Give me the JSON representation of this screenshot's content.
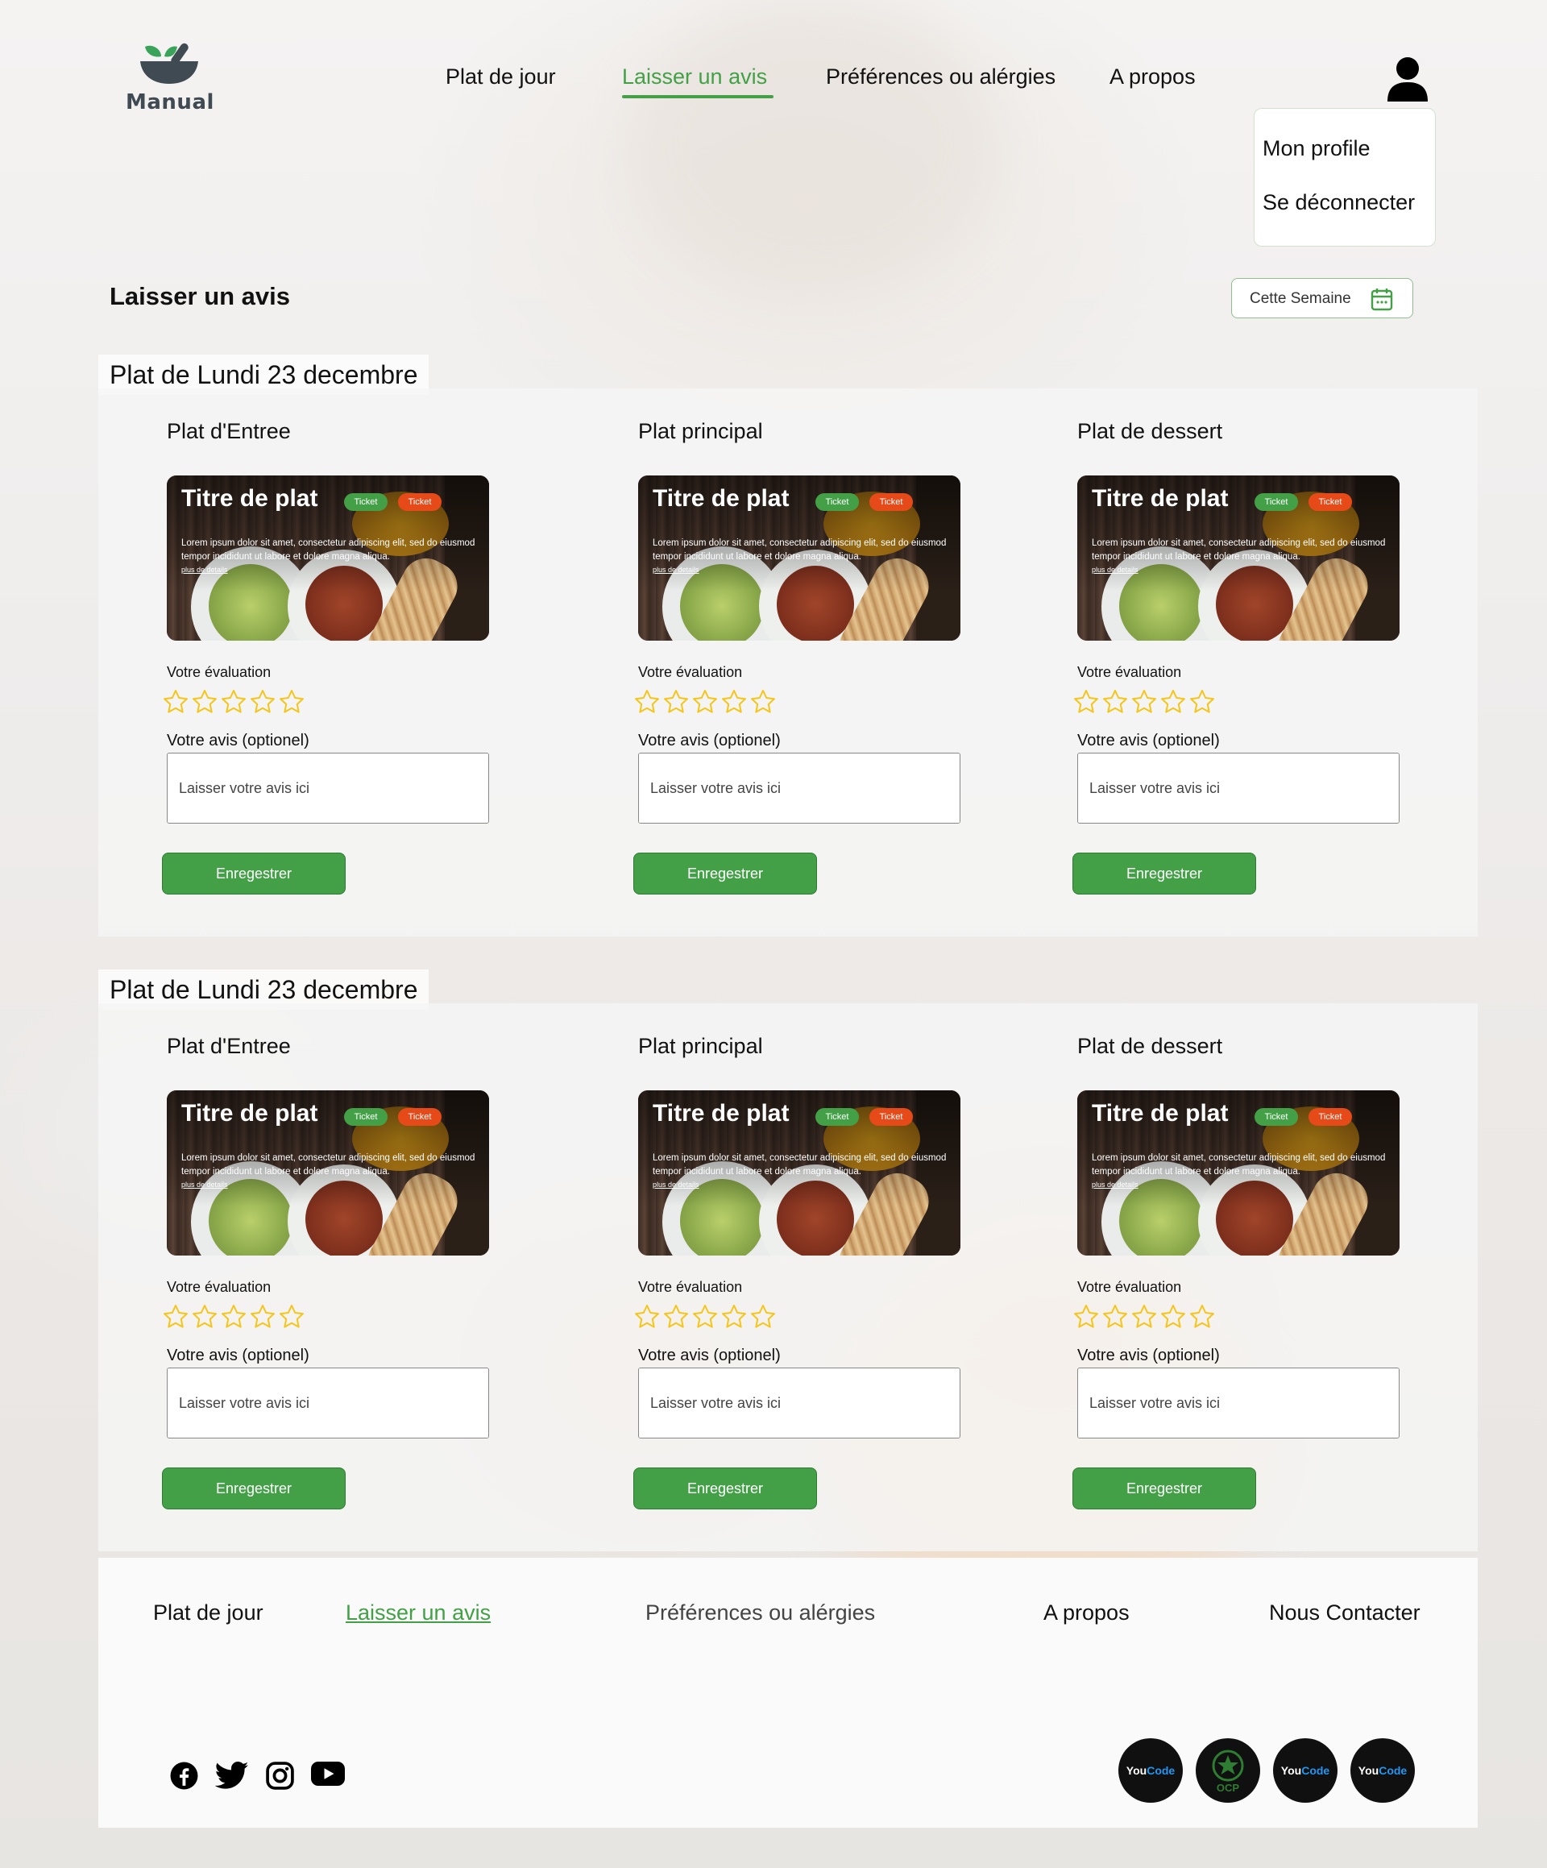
{
  "app": {
    "logo_text": "Manual"
  },
  "nav": {
    "items": [
      "Plat de jour",
      "Laisser un avis",
      "Préférences ou alérgies",
      "A propos"
    ],
    "active": "Laisser un avis"
  },
  "user_menu": {
    "items": [
      "Mon profile",
      "Se déconnecter"
    ]
  },
  "page": {
    "title": "Laisser un avis",
    "week_filter": "Cette Semaine"
  },
  "days": [
    {
      "title": "Plat de Lundi 23 decembre",
      "courses": [
        {
          "label": "Plat d'Entree",
          "dish_title": "Titre de plat",
          "tags": [
            "Ticket",
            "Ticket"
          ],
          "description": "Lorem ipsum dolor sit amet, consectetur adipiscing elit, sed do eiusmod tempor incididunt ut labore et dolore magna aliqua.",
          "more": "plus de details",
          "rating_label": "Votre évaluation",
          "rating": 0,
          "rating_max": 5,
          "opinion_label": "Votre avis (optionel)",
          "opinion_placeholder": "Laisser votre avis ici",
          "save": "Enregestrer"
        },
        {
          "label": "Plat principal",
          "dish_title": "Titre de plat",
          "tags": [
            "Ticket",
            "Ticket"
          ],
          "description": "Lorem ipsum dolor sit amet, consectetur adipiscing elit, sed do eiusmod tempor incididunt ut labore et dolore magna aliqua.",
          "more": "plus de details",
          "rating_label": "Votre évaluation",
          "rating": 0,
          "rating_max": 5,
          "opinion_label": "Votre avis (optionel)",
          "opinion_placeholder": "Laisser votre avis ici",
          "save": "Enregestrer"
        },
        {
          "label": "Plat de dessert",
          "dish_title": "Titre de plat",
          "tags": [
            "Ticket",
            "Ticket"
          ],
          "description": "Lorem ipsum dolor sit amet, consectetur adipiscing elit, sed do eiusmod tempor incididunt ut labore et dolore magna aliqua.",
          "more": "plus de details",
          "rating_label": "Votre évaluation",
          "rating": 0,
          "rating_max": 5,
          "opinion_label": "Votre avis (optionel)",
          "opinion_placeholder": "Laisser votre avis ici",
          "save": "Enregestrer"
        }
      ]
    },
    {
      "title": "Plat de Lundi 23 decembre",
      "courses": [
        {
          "label": "Plat d'Entree",
          "dish_title": "Titre de plat",
          "tags": [
            "Ticket",
            "Ticket"
          ],
          "description": "Lorem ipsum dolor sit amet, consectetur adipiscing elit, sed do eiusmod tempor incididunt ut labore et dolore magna aliqua.",
          "more": "plus de details",
          "rating_label": "Votre évaluation",
          "rating": 0,
          "rating_max": 5,
          "opinion_label": "Votre avis (optionel)",
          "opinion_placeholder": "Laisser votre avis ici",
          "save": "Enregestrer"
        },
        {
          "label": "Plat principal",
          "dish_title": "Titre de plat",
          "tags": [
            "Ticket",
            "Ticket"
          ],
          "description": "Lorem ipsum dolor sit amet, consectetur adipiscing elit, sed do eiusmod tempor incididunt ut labore et dolore magna aliqua.",
          "more": "plus de details",
          "rating_label": "Votre évaluation",
          "rating": 0,
          "rating_max": 5,
          "opinion_label": "Votre avis (optionel)",
          "opinion_placeholder": "Laisser votre avis ici",
          "save": "Enregestrer"
        },
        {
          "label": "Plat de dessert",
          "dish_title": "Titre de plat",
          "tags": [
            "Ticket",
            "Ticket"
          ],
          "description": "Lorem ipsum dolor sit amet, consectetur adipiscing elit, sed do eiusmod tempor incididunt ut labore et dolore magna aliqua.",
          "more": "plus de details",
          "rating_label": "Votre évaluation",
          "rating": 0,
          "rating_max": 5,
          "opinion_label": "Votre avis (optionel)",
          "opinion_placeholder": "Laisser votre avis ici",
          "save": "Enregestrer"
        }
      ]
    }
  ],
  "footer": {
    "links": [
      "Plat de jour",
      "Laisser un avis",
      "Préférences ou alérgies",
      "A propos",
      "Nous Contacter"
    ],
    "active": "Laisser un avis",
    "socials": [
      "facebook-icon",
      "twitter-icon",
      "instagram-icon",
      "youtube-icon"
    ],
    "partners": [
      {
        "name": "YouCode",
        "parts": [
          "You",
          "Code"
        ]
      },
      {
        "name": "OCP",
        "label": "OCP"
      },
      {
        "name": "YouCode",
        "parts": [
          "You",
          "Code"
        ]
      },
      {
        "name": "YouCode",
        "parts": [
          "You",
          "Code"
        ]
      }
    ]
  },
  "colors": {
    "accent": "#43a047",
    "tag_red": "#e64a19",
    "star": "#f5c518"
  }
}
